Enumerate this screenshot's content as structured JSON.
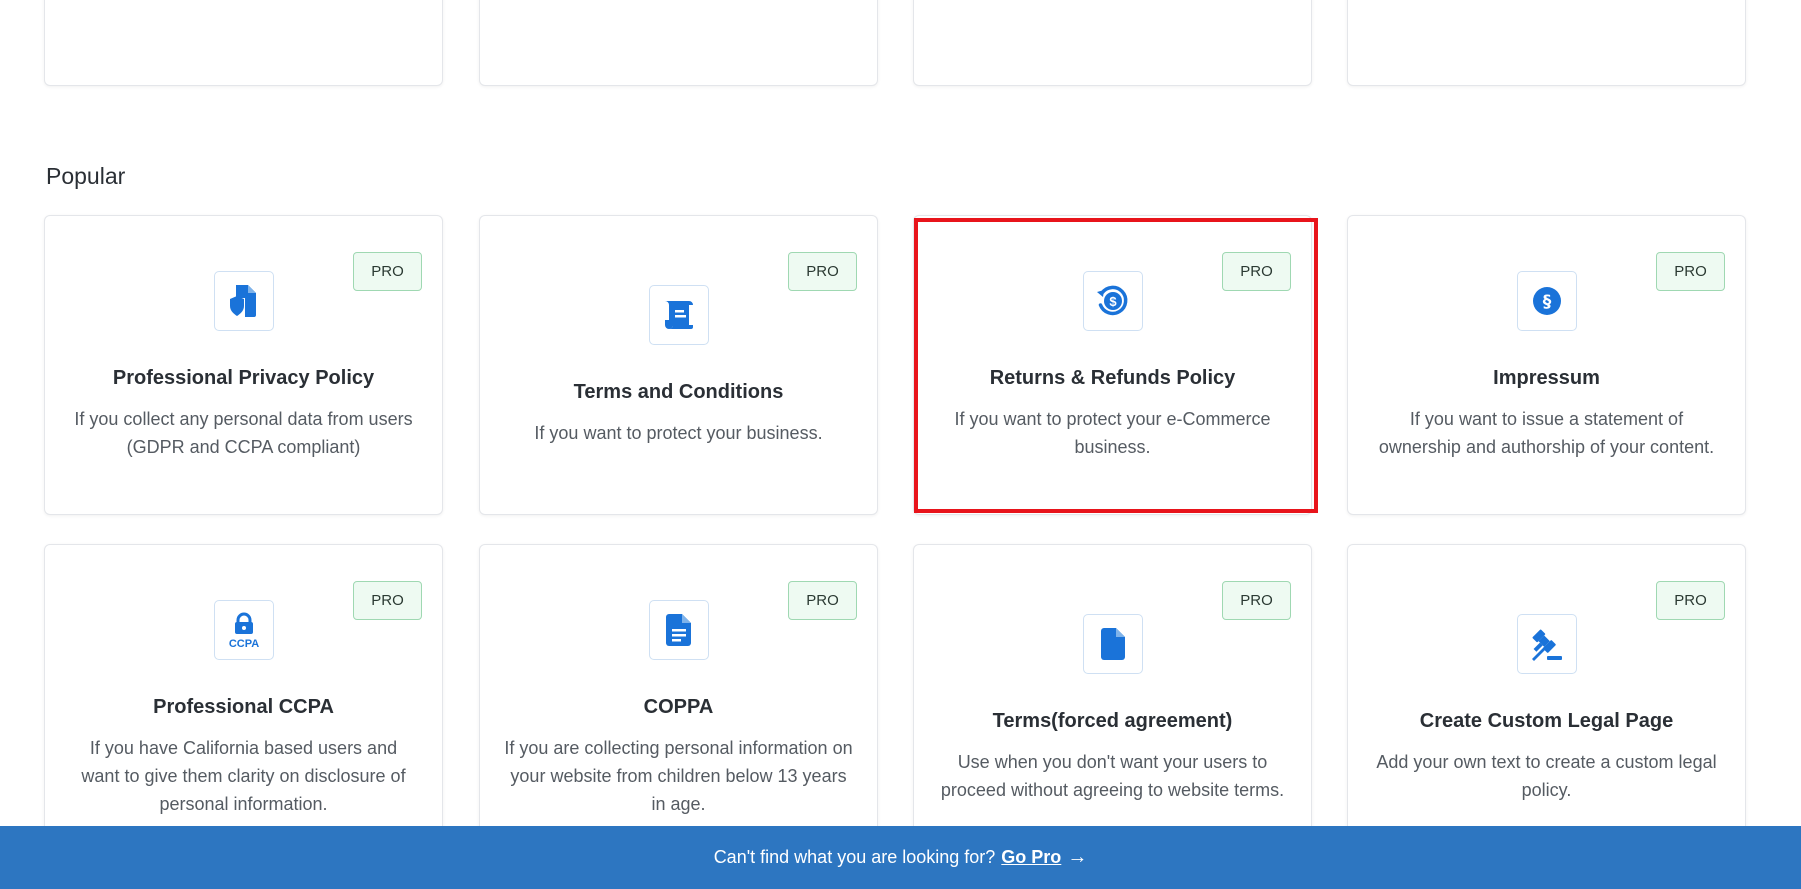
{
  "section": {
    "title": "Popular"
  },
  "cards": [
    {
      "title": "Professional Privacy Policy",
      "desc": "If you collect any personal data from users (GDPR and CCPA compliant)",
      "badge": "PRO",
      "icon": "shield-document-icon"
    },
    {
      "title": "Terms and Conditions",
      "desc": "If you want to protect your business.",
      "badge": "PRO",
      "icon": "scroll-icon"
    },
    {
      "title": "Returns & Refunds Policy",
      "desc": "If you want to protect your e-Commerce business.",
      "badge": "PRO",
      "icon": "refund-dollar-icon"
    },
    {
      "title": "Impressum",
      "desc": "If you want to issue a statement of ownership and authorship of your content.",
      "badge": "PRO",
      "icon": "section-sign-icon"
    },
    {
      "title": "Professional CCPA",
      "desc": "If you have California based users and want to give them clarity on disclosure of personal information.",
      "badge": "PRO",
      "icon": "lock-ccpa-icon",
      "icon_label": "CCPA"
    },
    {
      "title": "COPPA",
      "desc": "If you are collecting personal information on your website from children below 13 years in age.",
      "badge": "PRO",
      "icon": "document-lines-icon"
    },
    {
      "title": "Terms(forced agreement)",
      "desc": "Use when you don't want your users to proceed without agreeing to website terms.",
      "badge": "PRO",
      "icon": "document-icon"
    },
    {
      "title": "Create Custom Legal Page",
      "desc": "Add your own text to create a custom legal policy.",
      "badge": "PRO",
      "icon": "gavel-icon"
    }
  ],
  "footer": {
    "text": "Can't find what you are looking for?",
    "link": "Go Pro",
    "arrow": "→"
  },
  "colors": {
    "accent": "#2d76c1",
    "icon_blue": "#1a73d9",
    "highlight": "#e8141b",
    "badge_bg": "#eefaf2",
    "badge_border": "#9fd8b2"
  }
}
